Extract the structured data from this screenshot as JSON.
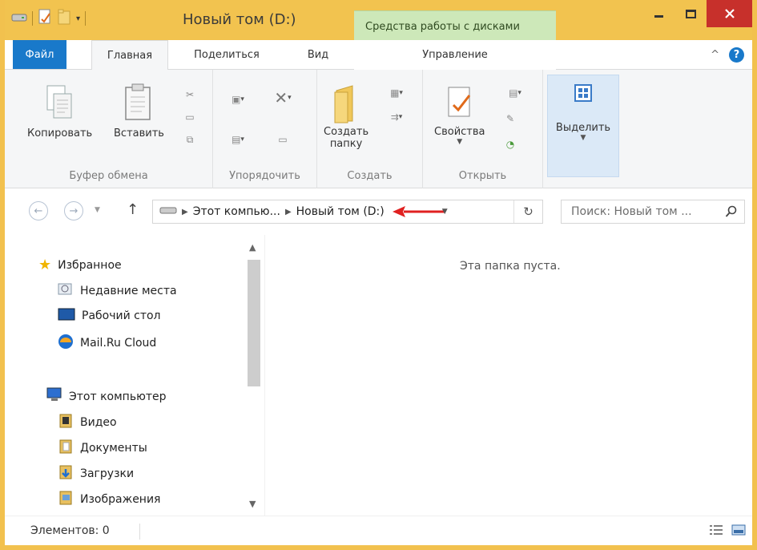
{
  "window": {
    "title": "Новый том (D:)",
    "context_tab": "Средства работы с дисками"
  },
  "tabs": {
    "file": "Файл",
    "home": "Главная",
    "share": "Поделиться",
    "view": "Вид",
    "manage": "Управление"
  },
  "ribbon": {
    "copy": "Копировать",
    "paste": "Вставить",
    "group_clipboard": "Буфер обмена",
    "group_organize": "Упорядочить",
    "new_folder_line1": "Создать",
    "new_folder_line2": "папку",
    "group_create": "Создать",
    "properties": "Свойства",
    "group_open": "Открыть",
    "select": "Выделить"
  },
  "address": {
    "crumbs": [
      "Этот компью...",
      "Новый том (D:)"
    ],
    "search_placeholder": "Поиск: Новый том ..."
  },
  "nav": {
    "favorites": "Избранное",
    "recent": "Недавние места",
    "desktop": "Рабочий стол",
    "mailru": "Mail.Ru Cloud",
    "computer": "Этот компьютер",
    "video": "Видео",
    "documents": "Документы",
    "downloads": "Загрузки",
    "pictures": "Изображения"
  },
  "content": {
    "empty_text": "Эта папка пуста."
  },
  "status": {
    "items": "Элементов: 0"
  },
  "colors": {
    "titlebar": "#f2c34f",
    "file_tab": "#1979ca",
    "close": "#c7302b",
    "context_tab": "#cde8b9",
    "arrow": "#e02020"
  }
}
